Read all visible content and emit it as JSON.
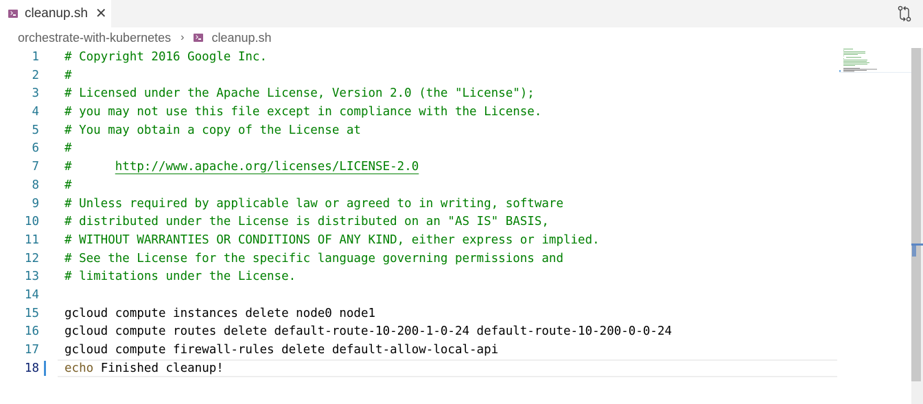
{
  "tab": {
    "label": "cleanup.sh",
    "close_glyph": "✕",
    "icon": "shell-script-icon"
  },
  "breadcrumb": {
    "folder": "orchestrate-with-kubernetes",
    "separator": "›",
    "file": "cleanup.sh"
  },
  "toolbar": {
    "compare_icon": "open-changes-icon"
  },
  "editor": {
    "active_line": 18,
    "lines": [
      {
        "n": "1",
        "type": "comment",
        "text": "# Copyright 2016 Google Inc."
      },
      {
        "n": "2",
        "type": "comment",
        "text": "#"
      },
      {
        "n": "3",
        "type": "comment",
        "text": "# Licensed under the Apache License, Version 2.0 (the \"License\");"
      },
      {
        "n": "4",
        "type": "comment",
        "text": "# you may not use this file except in compliance with the License."
      },
      {
        "n": "5",
        "type": "comment",
        "text": "# You may obtain a copy of the License at"
      },
      {
        "n": "6",
        "type": "comment",
        "text": "#"
      },
      {
        "n": "7",
        "type": "url",
        "prefix": "#      ",
        "text": "http://www.apache.org/licenses/LICENSE-2.0"
      },
      {
        "n": "8",
        "type": "comment",
        "text": "#"
      },
      {
        "n": "9",
        "type": "comment",
        "text": "# Unless required by applicable law or agreed to in writing, software"
      },
      {
        "n": "10",
        "type": "comment",
        "text": "# distributed under the License is distributed on an \"AS IS\" BASIS,"
      },
      {
        "n": "11",
        "type": "comment",
        "text": "# WITHOUT WARRANTIES OR CONDITIONS OF ANY KIND, either express or implied."
      },
      {
        "n": "12",
        "type": "comment",
        "text": "# See the License for the specific language governing permissions and"
      },
      {
        "n": "13",
        "type": "comment",
        "text": "# limitations under the License."
      },
      {
        "n": "14",
        "type": "plain",
        "text": ""
      },
      {
        "n": "15",
        "type": "plain",
        "text": "gcloud compute instances delete node0 node1"
      },
      {
        "n": "16",
        "type": "plain",
        "text": "gcloud compute routes delete default-route-10-200-1-0-24 default-route-10-200-0-0-24"
      },
      {
        "n": "17",
        "type": "plain",
        "text": "gcloud compute firewall-rules delete default-allow-local-api"
      },
      {
        "n": "18",
        "type": "echo",
        "keyword": "echo",
        "text": " Finished cleanup!"
      }
    ]
  },
  "colors": {
    "comment": "#008000",
    "line_number": "#237893",
    "keyword": "#795e26",
    "icon_purple": "#9b5a8e"
  }
}
